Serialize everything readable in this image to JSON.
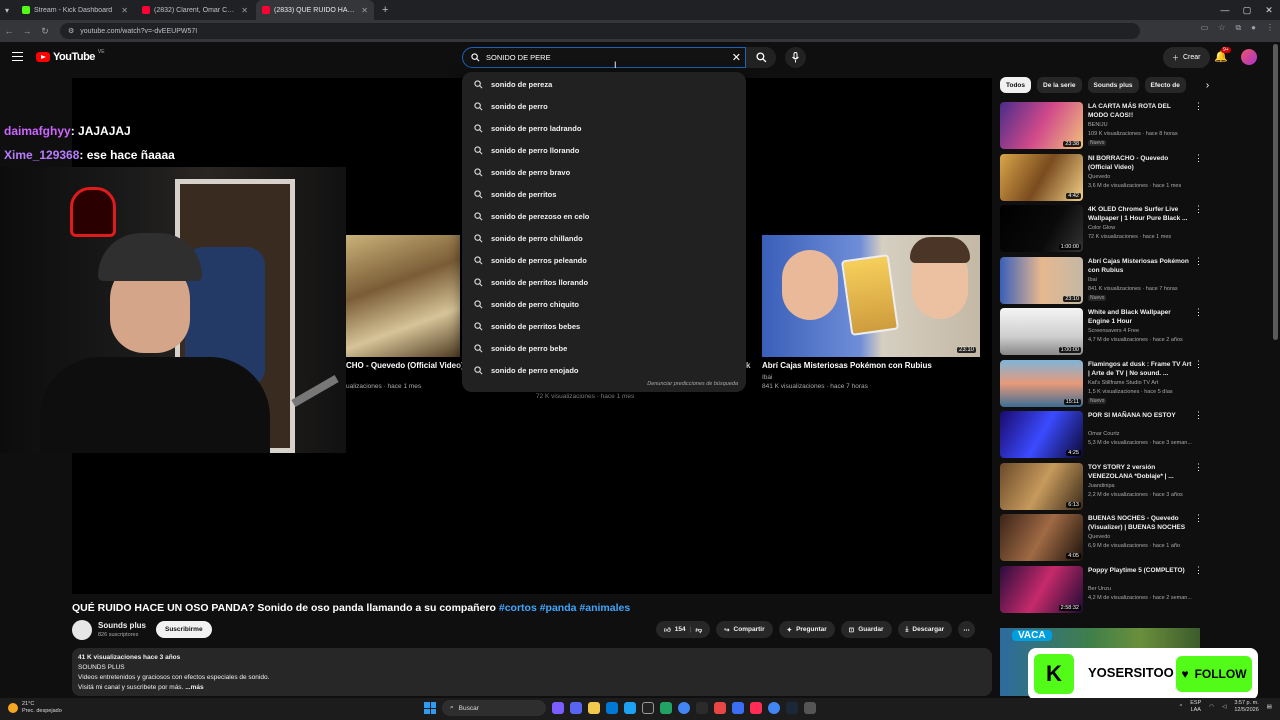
{
  "browser": {
    "tabs": [
      {
        "title": "Stream - Kick Dashboard",
        "color": "#53fc18",
        "active": false
      },
      {
        "title": "(2832) Clarent, Omar Courtz - S",
        "color": "#ff0033",
        "active": false
      },
      {
        "title": "(2833) QUÉ RUIDO HACE UN O",
        "color": "#ff0033",
        "active": true
      }
    ],
    "new_tab": "+",
    "url": "youtube.com/watch?v=-dvEEUPW57I"
  },
  "youtube": {
    "logo_text": "YouTube",
    "logo_region": "VE",
    "search_value": "SONIDO DE PERE",
    "create_label": "Crear",
    "notif_count": "9+",
    "suggestions": [
      "sonido de pereza",
      "sonido de perro",
      "sonido de perro ladrando",
      "sonido de perro llorando",
      "sonido de perro bravo",
      "sonido de perritos",
      "sonido de perezoso en celo",
      "sonido de perro chillando",
      "sonido de perros peleando",
      "sonido de perritos llorando",
      "sonido de perro chiquito",
      "sonido de perritos bebes",
      "sonido de perro bebe",
      "sonido de perro enojado"
    ],
    "report_predictions": "Denunciar predicciones de búsqueda"
  },
  "player": {
    "chat": [
      {
        "user": "daimafghyy",
        "message": ": JAJAJAJ"
      },
      {
        "user": "Xime_129368",
        "message": ": ese hace ñaaaa"
      }
    ],
    "end_a_title": "CHO - Quevedo (Official Video)",
    "end_a_meta": "ualizaciones · hace 1 mes",
    "end_mid_meta": "72 K visualizaciones · hace 1 mes",
    "end_b_title": "Abrí Cajas Misteriosas Pokémon con Rubius",
    "end_b_channel": "Ibai",
    "end_b_meta": "841 K visualizaciones · hace 7 horas",
    "end_b_duration": "23:10",
    "end_k": "k"
  },
  "chips": [
    "Todos",
    "De la serie",
    "Sounds plus",
    "Efecto de"
  ],
  "recommendations": [
    {
      "title": "LA CARTA MÁS ROTA DEL MODO CAOS!!",
      "channel": "BENIJU",
      "meta": "109 K visualizaciones · hace 8 horas",
      "duration": "23:38",
      "badge": "Nuevo",
      "thumb": "linear-gradient(120deg,#4a2c8a,#d14a8a 50%,#f1c27d)"
    },
    {
      "title": "NI BORRACHO - Quevedo (Official Video)",
      "channel": "Quevedo",
      "meta": "3,6 M de visualizaciones · hace 1 mes",
      "duration": "4:42",
      "badge": "",
      "thumb": "linear-gradient(120deg,#d9a54a,#7a4b1e 50%,#f0d08a)"
    },
    {
      "title": "4K OLED Chrome Surfer Live Wallpaper | 1 Hour Pure Black ...",
      "channel": "Color Glow",
      "meta": "72 K visualizaciones · hace 1 mes",
      "duration": "1:00:00",
      "badge": "",
      "thumb": "linear-gradient(120deg,#000,#0a0a0a 60%,#333)"
    },
    {
      "title": "Abrí Cajas Misteriosas Pokémon con Rubius",
      "channel": "Ibai",
      "meta": "841 K visualizaciones · hace 7 horas",
      "duration": "23:10",
      "badge": "Nuevo",
      "thumb": "linear-gradient(90deg,#3a5fb9,#e7b88f 50%,#c4b8a5)"
    },
    {
      "title": "White and Black Wallpaper Engine 1 Hour",
      "channel": "Screensavers 4 Free",
      "meta": "4,7 M de visualizaciones · hace 2 años",
      "duration": "1:00:00",
      "badge": "",
      "thumb": "linear-gradient(180deg,#f4f4f4,#cfcfcf 60%,#888)"
    },
    {
      "title": "Flamingos at dusk : Frame TV Art | Arte de TV | No sound. ...",
      "channel": "Kat's Stillframe Studio TV Art",
      "meta": "1,5 K visualizaciones · hace 5 días",
      "duration": "15:11",
      "badge": "Nuevo",
      "thumb": "linear-gradient(180deg,#7fb4d8,#e79a7a 50%,#3d6d94)"
    },
    {
      "title": "POR SI MAÑANA NO ESTOY",
      "channel": "Omar Courtz",
      "meta": "5,3 M de visualizaciones · hace 3 seman...",
      "duration": "4:25",
      "badge": "",
      "thumb": "linear-gradient(120deg,#1a0a6e,#3b4bff 50%,#0c0833)"
    },
    {
      "title": "TOY STORY 2 versión VENEZOLANA *Doblaje* | ...",
      "channel": "Juandinipa",
      "meta": "2,2 M de visualizaciones · hace 3 años",
      "duration": "6:13",
      "badge": "",
      "thumb": "linear-gradient(120deg,#6b4a2b,#c79a5c 50%,#3b2b1a)"
    },
    {
      "title": "BUENAS NOCHES - Quevedo (Visualizer) | BUENAS NOCHES",
      "channel": "Quevedo",
      "meta": "6,9 M de visualizaciones · hace 1 año",
      "duration": "4:05",
      "badge": "",
      "thumb": "linear-gradient(120deg,#3a2418,#a06a44 50%,#1c120c)"
    },
    {
      "title": "Poppy Playtime 5 (COMPLETO)",
      "channel": "Ber Unzu",
      "meta": "4,2 M de visualizaciones · hace 2 seman...",
      "duration": "2:58:32",
      "badge": "",
      "thumb": "linear-gradient(120deg,#2a0d3c,#c62a6b 50%,#1d0b33)"
    }
  ],
  "vaca_label": "VACA",
  "video": {
    "title": "QUÉ RUIDO HACE UN OSO PANDA? Sonido de oso panda llamando a su compañero",
    "hashtags": "#cortos #panda #animales",
    "channel": "Sounds plus",
    "subs": "826 suscriptores",
    "subscribe": "Suscribirme",
    "likes": "154",
    "share": "Compartir",
    "ask": "Preguntar",
    "save": "Guardar",
    "download": "Descargar",
    "desc_stats": "41 K visualizaciones  hace 3 años",
    "desc_line1": "SOUNDS PLUS",
    "desc_line2": "Videos entretenidos y graciosos con efectos especiales de sonido.",
    "desc_line3": "Visitá mi canal y suscribete por más.",
    "desc_more": "...más"
  },
  "kick_overlay": {
    "logo": "K",
    "name": "YOSERSITOO",
    "follow": "FOLLOW"
  },
  "taskbar": {
    "temp": "21°C",
    "weather": "Prec. despejado",
    "search": "Buscar",
    "lang": "ESP",
    "lang2": "LAA",
    "time": "3:57 p. m.",
    "date": "12/5/2026"
  }
}
